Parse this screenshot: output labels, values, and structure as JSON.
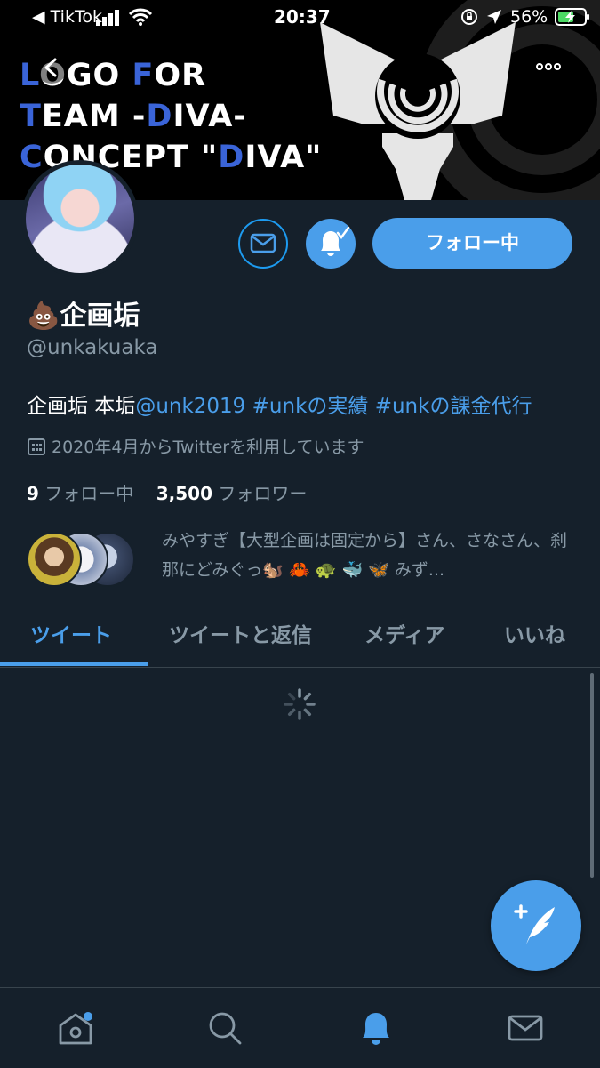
{
  "status_bar": {
    "carrier": "◀ TikTok",
    "time": "20:37",
    "battery_percent": "56%"
  },
  "banner": {
    "lines": [
      {
        "first": "L",
        "rest": "OGO "
      },
      {
        "first": "T",
        "rest": "EAM -"
      },
      {
        "first": "C",
        "rest": "ONCEPT \""
      }
    ],
    "line1_mid": "F",
    "line1_end": "OR",
    "line2_mid": "D",
    "line2_end": "IVA-",
    "line3_mid": "D",
    "line3_end": "IVA\""
  },
  "profile": {
    "name": "企画垢",
    "name_emoji": "💩",
    "handle": "@unkakuaka",
    "bio_text": "企画垢 本垢",
    "bio_links": [
      "@unk2019",
      "#unkの実績",
      "#unkの課金代行"
    ],
    "joined": "2020年4月からTwitterを利用しています",
    "following_count": "9",
    "following_label": "フォロー中",
    "followers_count": "3,500",
    "followers_label": "フォロワー",
    "known_followers": "みやすぎ【大型企画は固定から】さん、さなさん、刹那にどみぐっ🐿️ 🦀 🐢 🐳 🦋 みず..."
  },
  "actions": {
    "follow_button_label": "フォロー中"
  },
  "tabs": [
    {
      "label": "ツイート",
      "active": true
    },
    {
      "label": "ツイートと返信",
      "active": false
    },
    {
      "label": "メディア",
      "active": false
    },
    {
      "label": "いいね",
      "active": false
    }
  ],
  "colors": {
    "background": "#15202b",
    "accent": "#4a9eea",
    "secondary_text": "#8899a6",
    "banner_accent": "#3a64d8"
  },
  "icons": {
    "back": "back-arrow-icon",
    "more": "more-dots-icon",
    "message": "envelope-icon",
    "notifications": "bell-check-icon",
    "calendar": "calendar-icon",
    "loading": "spinner-icon",
    "compose": "compose-quill-icon",
    "nav": [
      "home-icon",
      "search-icon",
      "bell-icon",
      "envelope-icon"
    ]
  }
}
